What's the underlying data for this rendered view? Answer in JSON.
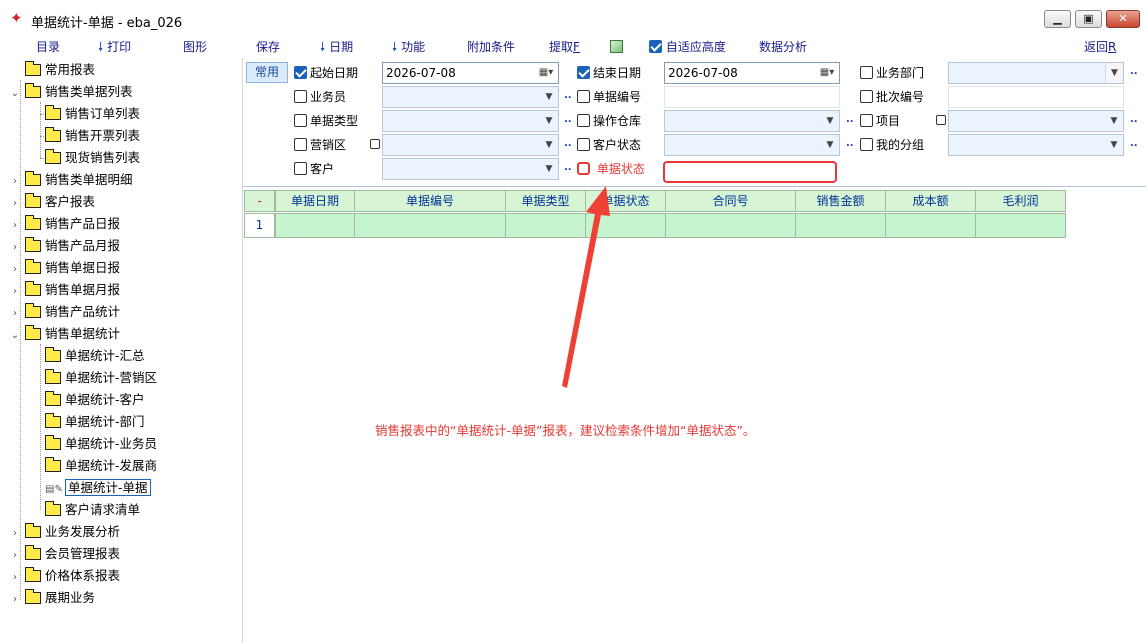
{
  "window": {
    "title": "单据统计-单据 - eba_026",
    "min_glyph": "▁",
    "max_glyph": "▣",
    "close_glyph": "✕"
  },
  "menu": {
    "catalog": "目录",
    "print": "打印",
    "chart": "图形",
    "save": "保存",
    "date": "日期",
    "function": "功能",
    "extra": "附加条件",
    "extract": "提取",
    "extract_key": "F",
    "auto_height": "自适应高度",
    "analysis": "数据分析",
    "back": "返回",
    "back_key": "R"
  },
  "tree": {
    "items": [
      {
        "label": "常用报表"
      },
      {
        "label": "销售类单据列表"
      },
      {
        "label": "销售订单列表"
      },
      {
        "label": "销售开票列表"
      },
      {
        "label": "现货销售列表"
      },
      {
        "label": "销售类单据明细"
      },
      {
        "label": "客户报表"
      },
      {
        "label": "销售产品日报"
      },
      {
        "label": "销售产品月报"
      },
      {
        "label": "销售单据日报"
      },
      {
        "label": "销售单据月报"
      },
      {
        "label": "销售产品统计"
      },
      {
        "label": "销售单据统计"
      },
      {
        "label": "单据统计-汇总"
      },
      {
        "label": "单据统计-营销区"
      },
      {
        "label": "单据统计-客户"
      },
      {
        "label": "单据统计-部门"
      },
      {
        "label": "单据统计-业务员"
      },
      {
        "label": "单据统计-发展商"
      },
      {
        "label": "单据统计-单据"
      },
      {
        "label": "客户请求清单"
      },
      {
        "label": "业务发展分析"
      },
      {
        "label": "会员管理报表"
      },
      {
        "label": "价格体系报表"
      },
      {
        "label": "展期业务"
      }
    ]
  },
  "filters": {
    "common_tab": "常用",
    "start_date_label": "起始日期",
    "start_date": "2026-07-08",
    "end_date_label": "结束日期",
    "end_date": "2026-07-08",
    "department": "业务部门",
    "salesman": "业务员",
    "doc_no": "单据编号",
    "batch_no": "批次编号",
    "doc_type": "单据类型",
    "warehouse": "操作仓库",
    "project": "项目",
    "region": "营销区",
    "customer_status": "客户状态",
    "my_group": "我的分组",
    "customer": "客户",
    "doc_status": "单据状态",
    "dots": "..",
    "dropdown_glyph": "▼",
    "calendar_glyph": "▦▾"
  },
  "grid": {
    "corner": "-",
    "columns": [
      "单据日期",
      "单据编号",
      "单据类型",
      "单据状态",
      "合同号",
      "销售金额",
      "成本额",
      "毛利润"
    ],
    "row_number": "1"
  },
  "annotation": {
    "text": "销售报表中的“单据统计-单据”报表，建议检索条件增加“单据状态”。",
    "color": "#e53935"
  },
  "colors": {
    "grid_header": "#d7f5d4",
    "grid_row": "#c6f4cf",
    "input_bg": "#eaf3fe",
    "folder": "#ffea4a",
    "accent": "#1c62b9"
  }
}
